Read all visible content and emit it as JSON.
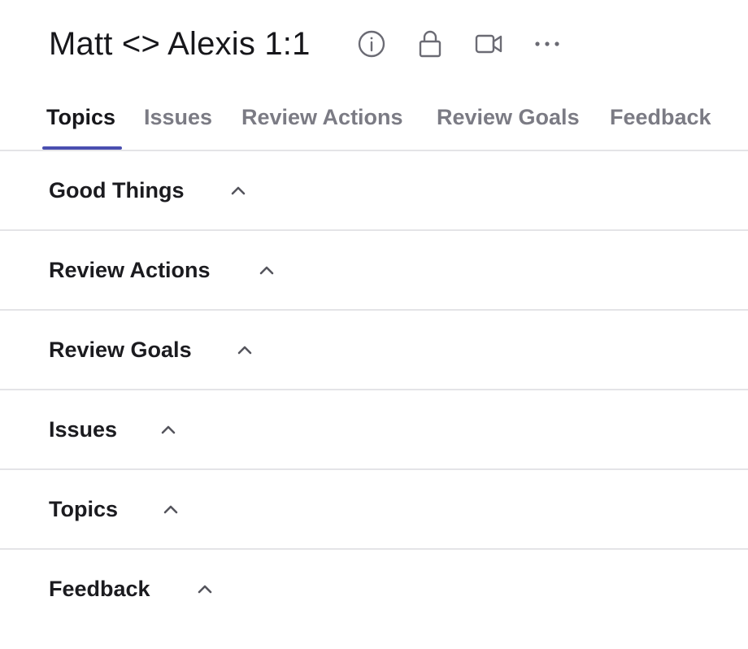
{
  "header": {
    "title": "Matt <> Alexis 1:1",
    "icons": [
      "info-icon",
      "lock-icon",
      "video-icon",
      "more-icon"
    ]
  },
  "tabs": [
    {
      "label": "Topics",
      "active": true
    },
    {
      "label": "Issues",
      "active": false
    },
    {
      "label": "Review Actions",
      "active": false
    },
    {
      "label": "Review Goals",
      "active": false
    },
    {
      "label": "Feedback",
      "active": false
    }
  ],
  "sections": [
    {
      "title": "Good Things",
      "expanded": true
    },
    {
      "title": "Review Actions",
      "expanded": true
    },
    {
      "title": "Review Goals",
      "expanded": true
    },
    {
      "title": "Issues",
      "expanded": true
    },
    {
      "title": "Topics",
      "expanded": true
    },
    {
      "title": "Feedback",
      "expanded": true
    }
  ],
  "colors": {
    "accent": "#4a4fb0",
    "text": "#1b1b1f",
    "muted": "#7b7b84",
    "divider": "#e4e4e7"
  }
}
